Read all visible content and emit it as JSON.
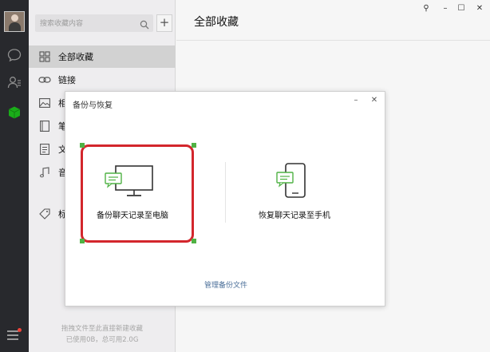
{
  "colors": {
    "rail_bg": "#28292d",
    "accent_green": "#1aad19",
    "highlight_red": "#d3262c",
    "active_item_bg": "#d2d2d2",
    "link": "#4b6f99"
  },
  "rail": {
    "icons": [
      "chat-bubble-icon",
      "contacts-icon",
      "favorites-cube-icon"
    ],
    "menu_icon": "menu-icon",
    "has_notification_dot": true
  },
  "search": {
    "placeholder": "搜索收藏内容"
  },
  "add_button": {
    "label": "+"
  },
  "nav": {
    "items": [
      {
        "label": "全部收藏",
        "icon": "grid-icon",
        "active": true
      },
      {
        "label": "链接",
        "icon": "link-icon",
        "active": false
      },
      {
        "label": "相",
        "icon": "image-icon",
        "active": false
      },
      {
        "label": "笔",
        "icon": "notebook-icon",
        "active": false
      },
      {
        "label": "文",
        "icon": "document-icon",
        "active": false
      },
      {
        "label": "音",
        "icon": "music-icon",
        "active": false
      },
      {
        "label": "标",
        "icon": "tag-icon",
        "active": false
      }
    ]
  },
  "footer": {
    "hint": "拖拽文件至此直接新建收藏",
    "storage": "已使用0B，总可用2.0G"
  },
  "main": {
    "title": "全部收藏"
  },
  "window_controls": {
    "pin": "⚲",
    "minimize": "–",
    "maximize": "☐",
    "close": "✕"
  },
  "modal": {
    "title": "备份与恢复",
    "minimize": "–",
    "close": "✕",
    "options": [
      {
        "label": "备份聊天记录至电脑",
        "icon": "monitor-chat-icon",
        "highlighted": true
      },
      {
        "label": "恢复聊天记录至手机",
        "icon": "phone-chat-icon",
        "highlighted": false
      }
    ],
    "manage_link": "管理备份文件"
  }
}
